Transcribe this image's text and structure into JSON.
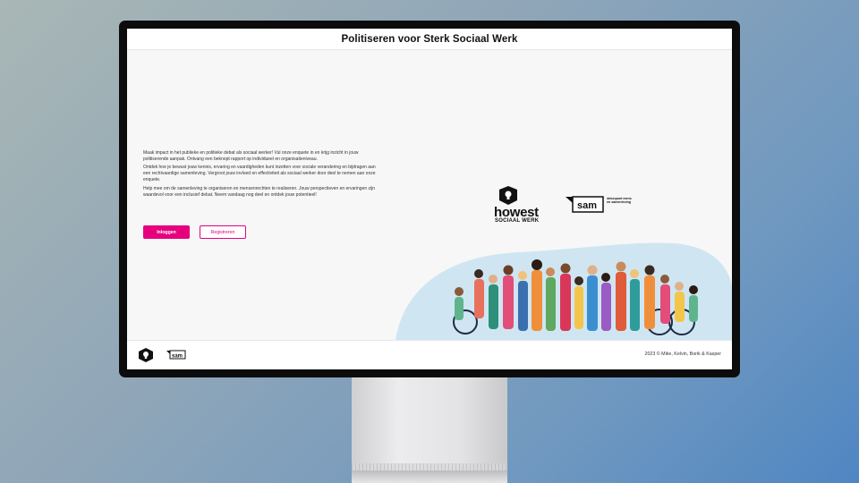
{
  "header": {
    "title": "Politiseren voor Sterk Sociaal Werk"
  },
  "intro": {
    "paragraphs": [
      "Maak impact in het publieke en politieke debat als sociaal werker! Vul onze enquete in en krijg inzicht in jouw politiserende aanpak. Ontvang een beknopt rapport op individueel en organisatieniveau.",
      "Ontdek hoe je bewust jouw kennis, ervaring en vaardigheden kunt inzetten voor sociale verandering en bijdragen aan een rechtvaardige samenleving. Vergroot jouw invloed en effectiviteit als sociaal werker door deel te nemen aan onze enquete.",
      "Help mee om de samenleving te organiseren en mensenrechten te realiseren. Jouw perspectieven en ervaringen zijn waardevol voor een inclusief debat. Neem vandaag nog deel en ontdek jouw potentieel!"
    ]
  },
  "buttons": {
    "login": "Inloggen",
    "register": "Registreren"
  },
  "logos": {
    "howest": "howest",
    "howest_sub": "SOCIAAL WERK",
    "sam": "sam",
    "sam_tag_line1": "steunpunt mens",
    "sam_tag_line2": "en samenleving"
  },
  "footer": {
    "copyright": "2023 © Mike, Kelvin, Borik & Kasper"
  },
  "colors": {
    "accent": "#e6007e",
    "background": "#f7f7f7",
    "illustration_blob": "#cfe6f2"
  },
  "icons": [
    "howest-logo-icon",
    "sam-logo-icon",
    "people-illustration"
  ]
}
